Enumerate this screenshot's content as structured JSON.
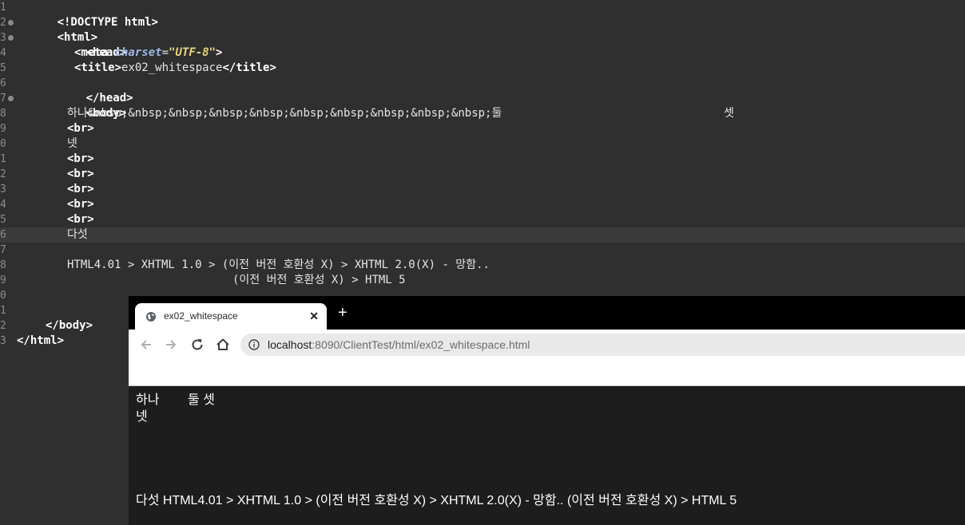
{
  "editor": {
    "line_numbers": [
      "1",
      "2",
      "3",
      "4",
      "5",
      "6",
      "7",
      "8",
      "9",
      "0",
      "1",
      "2",
      "3",
      "4",
      "5",
      "6",
      "7",
      "8",
      "9",
      "0",
      "1",
      "2",
      "3"
    ],
    "line1": {
      "doctype": "<!DOCTYPE html>"
    },
    "line2": {
      "open": "<html>"
    },
    "line3": {
      "open": "<head>"
    },
    "line4": {
      "tag": "<meta ",
      "attr": "charset",
      "eq": "=",
      "value": "\"UTF-8\"",
      "close": ">"
    },
    "line5": {
      "open": "<title>",
      "text": "ex02_whitespace",
      "close": "</title>"
    },
    "line6": {
      "close": "</head>"
    },
    "line7": {
      "open": "<body>"
    },
    "line8": {
      "text1": "하나&nbsp;&nbsp;&nbsp;&nbsp;&nbsp;&nbsp;&nbsp;&nbsp;&nbsp;&nbsp;둘",
      "text2": "셋"
    },
    "line9": {
      "tag": "<br>"
    },
    "line10": {
      "text": "넷"
    },
    "line11": {
      "tag": "<br>"
    },
    "line12": {
      "tag": "<br>"
    },
    "line13": {
      "tag": "<br>"
    },
    "line14": {
      "tag": "<br>"
    },
    "line15": {
      "tag": "<br>"
    },
    "line16": {
      "text": "다섯"
    },
    "line18": {
      "text": "HTML4.01 > XHTML 1.0 > (이전 버전 호환성 X) > XHTML 2.0(X) - 망함.."
    },
    "line19": {
      "text": "(이전 버전 호환성 X) > HTML 5"
    },
    "line22": {
      "close": "</body>"
    },
    "line23": {
      "close": "</html>"
    }
  },
  "browser": {
    "tab_title": "ex02_whitespace",
    "tab_close": "✕",
    "new_tab": "+",
    "url_host": "localhost",
    "url_rest": ":8090/ClientTest/html/ex02_whitespace.html",
    "icons": {
      "tab": "globe-icon",
      "back": "back-arrow-icon",
      "forward": "forward-arrow-icon",
      "reload": "reload-icon",
      "home": "home-icon",
      "info": "info-icon"
    },
    "content": {
      "line1": "하나        둘 셋",
      "line2": "넷",
      "line3": "다섯 HTML4.01 > XHTML 1.0 > (이전 버전 호환성 X) > XHTML 2.0(X) - 망함.. (이전 버전 호환성 X) > HTML 5"
    }
  }
}
